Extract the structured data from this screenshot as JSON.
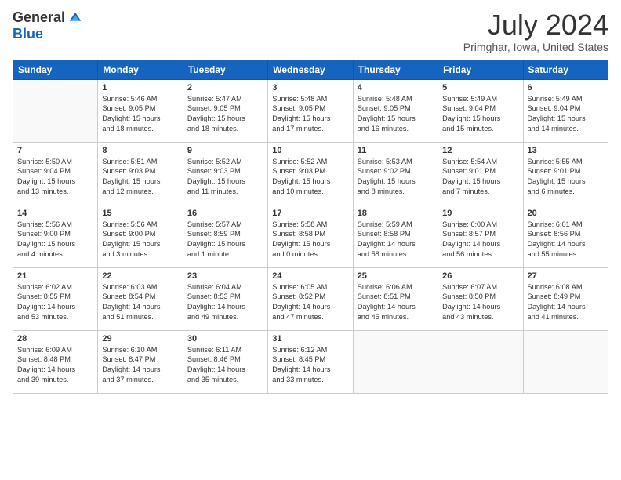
{
  "header": {
    "logo_general": "General",
    "logo_blue": "Blue",
    "month_title": "July 2024",
    "location": "Primghar, Iowa, United States"
  },
  "days_of_week": [
    "Sunday",
    "Monday",
    "Tuesday",
    "Wednesday",
    "Thursday",
    "Friday",
    "Saturday"
  ],
  "weeks": [
    [
      {
        "num": "",
        "info": ""
      },
      {
        "num": "1",
        "info": "Sunrise: 5:46 AM\nSunset: 9:05 PM\nDaylight: 15 hours\nand 18 minutes."
      },
      {
        "num": "2",
        "info": "Sunrise: 5:47 AM\nSunset: 9:05 PM\nDaylight: 15 hours\nand 18 minutes."
      },
      {
        "num": "3",
        "info": "Sunrise: 5:48 AM\nSunset: 9:05 PM\nDaylight: 15 hours\nand 17 minutes."
      },
      {
        "num": "4",
        "info": "Sunrise: 5:48 AM\nSunset: 9:05 PM\nDaylight: 15 hours\nand 16 minutes."
      },
      {
        "num": "5",
        "info": "Sunrise: 5:49 AM\nSunset: 9:04 PM\nDaylight: 15 hours\nand 15 minutes."
      },
      {
        "num": "6",
        "info": "Sunrise: 5:49 AM\nSunset: 9:04 PM\nDaylight: 15 hours\nand 14 minutes."
      }
    ],
    [
      {
        "num": "7",
        "info": "Sunrise: 5:50 AM\nSunset: 9:04 PM\nDaylight: 15 hours\nand 13 minutes."
      },
      {
        "num": "8",
        "info": "Sunrise: 5:51 AM\nSunset: 9:03 PM\nDaylight: 15 hours\nand 12 minutes."
      },
      {
        "num": "9",
        "info": "Sunrise: 5:52 AM\nSunset: 9:03 PM\nDaylight: 15 hours\nand 11 minutes."
      },
      {
        "num": "10",
        "info": "Sunrise: 5:52 AM\nSunset: 9:03 PM\nDaylight: 15 hours\nand 10 minutes."
      },
      {
        "num": "11",
        "info": "Sunrise: 5:53 AM\nSunset: 9:02 PM\nDaylight: 15 hours\nand 8 minutes."
      },
      {
        "num": "12",
        "info": "Sunrise: 5:54 AM\nSunset: 9:01 PM\nDaylight: 15 hours\nand 7 minutes."
      },
      {
        "num": "13",
        "info": "Sunrise: 5:55 AM\nSunset: 9:01 PM\nDaylight: 15 hours\nand 6 minutes."
      }
    ],
    [
      {
        "num": "14",
        "info": "Sunrise: 5:56 AM\nSunset: 9:00 PM\nDaylight: 15 hours\nand 4 minutes."
      },
      {
        "num": "15",
        "info": "Sunrise: 5:56 AM\nSunset: 9:00 PM\nDaylight: 15 hours\nand 3 minutes."
      },
      {
        "num": "16",
        "info": "Sunrise: 5:57 AM\nSunset: 8:59 PM\nDaylight: 15 hours\nand 1 minute."
      },
      {
        "num": "17",
        "info": "Sunrise: 5:58 AM\nSunset: 8:58 PM\nDaylight: 15 hours\nand 0 minutes."
      },
      {
        "num": "18",
        "info": "Sunrise: 5:59 AM\nSunset: 8:58 PM\nDaylight: 14 hours\nand 58 minutes."
      },
      {
        "num": "19",
        "info": "Sunrise: 6:00 AM\nSunset: 8:57 PM\nDaylight: 14 hours\nand 56 minutes."
      },
      {
        "num": "20",
        "info": "Sunrise: 6:01 AM\nSunset: 8:56 PM\nDaylight: 14 hours\nand 55 minutes."
      }
    ],
    [
      {
        "num": "21",
        "info": "Sunrise: 6:02 AM\nSunset: 8:55 PM\nDaylight: 14 hours\nand 53 minutes."
      },
      {
        "num": "22",
        "info": "Sunrise: 6:03 AM\nSunset: 8:54 PM\nDaylight: 14 hours\nand 51 minutes."
      },
      {
        "num": "23",
        "info": "Sunrise: 6:04 AM\nSunset: 8:53 PM\nDaylight: 14 hours\nand 49 minutes."
      },
      {
        "num": "24",
        "info": "Sunrise: 6:05 AM\nSunset: 8:52 PM\nDaylight: 14 hours\nand 47 minutes."
      },
      {
        "num": "25",
        "info": "Sunrise: 6:06 AM\nSunset: 8:51 PM\nDaylight: 14 hours\nand 45 minutes."
      },
      {
        "num": "26",
        "info": "Sunrise: 6:07 AM\nSunset: 8:50 PM\nDaylight: 14 hours\nand 43 minutes."
      },
      {
        "num": "27",
        "info": "Sunrise: 6:08 AM\nSunset: 8:49 PM\nDaylight: 14 hours\nand 41 minutes."
      }
    ],
    [
      {
        "num": "28",
        "info": "Sunrise: 6:09 AM\nSunset: 8:48 PM\nDaylight: 14 hours\nand 39 minutes."
      },
      {
        "num": "29",
        "info": "Sunrise: 6:10 AM\nSunset: 8:47 PM\nDaylight: 14 hours\nand 37 minutes."
      },
      {
        "num": "30",
        "info": "Sunrise: 6:11 AM\nSunset: 8:46 PM\nDaylight: 14 hours\nand 35 minutes."
      },
      {
        "num": "31",
        "info": "Sunrise: 6:12 AM\nSunset: 8:45 PM\nDaylight: 14 hours\nand 33 minutes."
      },
      {
        "num": "",
        "info": ""
      },
      {
        "num": "",
        "info": ""
      },
      {
        "num": "",
        "info": ""
      }
    ]
  ]
}
